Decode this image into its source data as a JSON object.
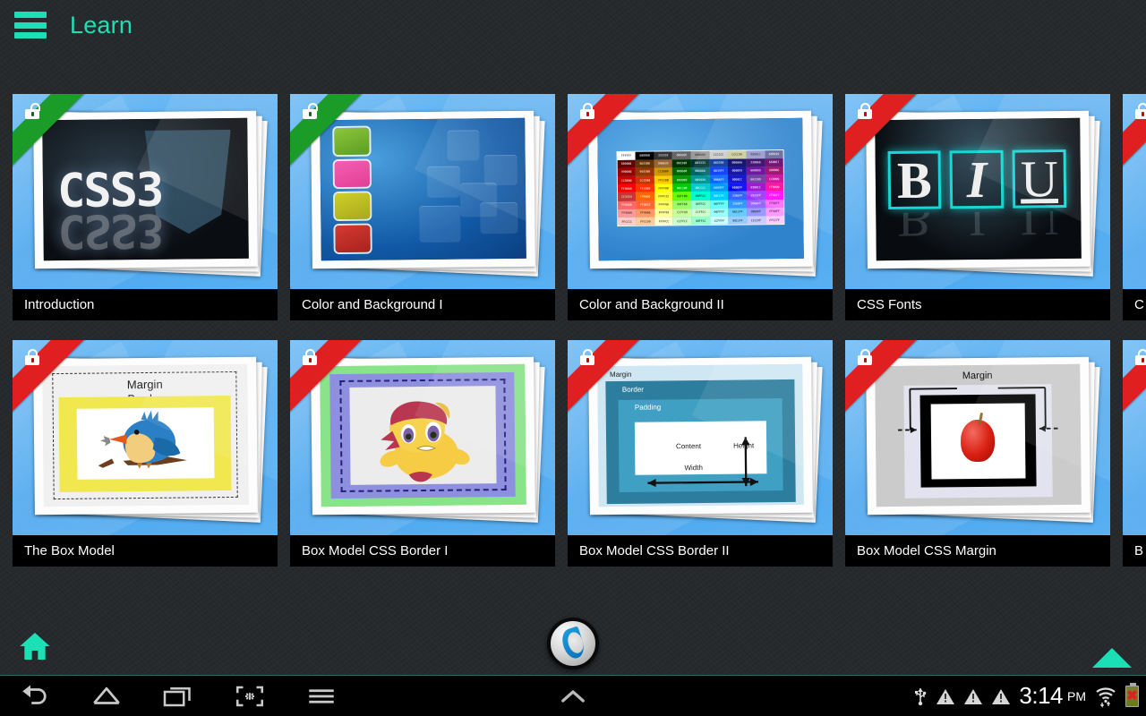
{
  "header": {
    "title": "Learn",
    "menu_icon": "hamburger-menu-icon",
    "accent_color": "#1ce0b5"
  },
  "lessons": {
    "rows": [
      {
        "cards": [
          {
            "title": "Introduction",
            "lock_state": "unlocked",
            "ribbon_color": "#1b9b28",
            "art": "css3-logo"
          },
          {
            "title": "Color and Background I",
            "lock_state": "unlocked",
            "ribbon_color": "#1b9b28",
            "art": "color-swatches"
          },
          {
            "title": "Color and Background II",
            "lock_state": "locked",
            "ribbon_color": "#e02020",
            "art": "hex-color-table"
          },
          {
            "title": "CSS Fonts",
            "lock_state": "locked",
            "ribbon_color": "#e02020",
            "art": "bold-italic-underline"
          },
          {
            "title": "C",
            "lock_state": "locked",
            "ribbon_color": "#e02020",
            "art": "partial"
          }
        ]
      },
      {
        "cards": [
          {
            "title": "The Box Model",
            "lock_state": "locked",
            "ribbon_color": "#e02020",
            "art": "bird-box-model"
          },
          {
            "title": "Box Model CSS Border I",
            "lock_state": "locked",
            "ribbon_color": "#e02020",
            "art": "pony-border"
          },
          {
            "title": "Box Model CSS Border II",
            "lock_state": "locked",
            "ribbon_color": "#e02020",
            "art": "box-model-diagram"
          },
          {
            "title": "Box Model CSS Margin",
            "lock_state": "locked",
            "ribbon_color": "#e02020",
            "art": "apple-margin"
          },
          {
            "title": "B",
            "lock_state": "locked",
            "ribbon_color": "#e02020",
            "art": "partial"
          }
        ]
      }
    ]
  },
  "art_text": {
    "css3": "CSS3",
    "bird_margin": "Margin",
    "bird_border": "Border",
    "biu": [
      "B",
      "I",
      "U"
    ],
    "box_model": {
      "margin": "Margin",
      "border": "Border",
      "padding": "Padding",
      "content": "Content",
      "width": "Width",
      "height": "Height"
    },
    "apple_margin": "Margin"
  },
  "hex_table": {
    "rows": [
      [
        "FFFFFF",
        "000000",
        "333333",
        "666666",
        "999999",
        "CCCCCC",
        "CCCC99",
        "9999CC",
        "666699"
      ],
      [
        "660000",
        "663300",
        "996633",
        "003300",
        "003333",
        "003399",
        "000066",
        "330066",
        "660067"
      ],
      [
        "990000",
        "993300",
        "CC9900",
        "006600",
        "006666",
        "0033FF",
        "000099",
        "660099",
        "990066"
      ],
      [
        "CC0000",
        "CC3300",
        "FFCC00",
        "009900",
        "009999",
        "0066FF",
        "0000CC",
        "663399",
        "CC0099"
      ],
      [
        "FF0000",
        "FF3300",
        "FFFF00",
        "00CC00",
        "00CCCC",
        "0099FF",
        "0000FF",
        "9900CC",
        "FF0099"
      ],
      [
        "CC3333",
        "FF6600",
        "FFFF33",
        "66FF00",
        "00FFCC",
        "00CCFF",
        "3366FF",
        "9933FF",
        "FF00FF"
      ],
      [
        "FF6666",
        "FF6633",
        "FFFF66",
        "99FF66",
        "99FFCC",
        "66FFFF",
        "3399FF",
        "9966FF",
        "FF66FF"
      ],
      [
        "FF9999",
        "FF9966",
        "FFFF99",
        "CCFF99",
        "CCFFCC",
        "99FFFF",
        "66CCFF",
        "9999FF",
        "FF99FF"
      ],
      [
        "FFCCCC",
        "FFCC99",
        "FFFFCC",
        "CCFFCC",
        "99FFCC",
        "CCFFFF",
        "99CCFF",
        "CCCCFF",
        "FFCCFF"
      ]
    ]
  },
  "bottom_bar": {
    "home_icon": "home-icon",
    "logo_icon": "app-logo-icon",
    "scroll_up_icon": "scroll-up-arrow-icon"
  },
  "system_nav": {
    "back_icon": "back-arrow-icon",
    "home_icon": "home-outline-icon",
    "recents_icon": "recent-apps-icon",
    "screenshot_icon": "screenshot-icon",
    "menu_icon": "menu-icon",
    "expand_icon": "chevron-up-icon"
  },
  "status_bar": {
    "usb_icon": "usb-icon",
    "warnings": [
      "warning-triangle-icon",
      "warning-triangle-icon",
      "warning-triangle-icon"
    ],
    "time": "3:14",
    "meridiem": "PM",
    "wifi_icon": "wifi-data-icon",
    "battery_icon": "battery-error-icon"
  }
}
